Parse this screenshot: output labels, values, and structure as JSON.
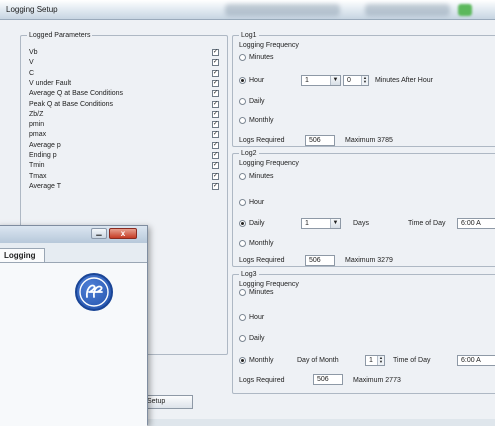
{
  "window": {
    "title": "Logging Setup"
  },
  "params": {
    "group_title": "Logged Parameters",
    "items": [
      {
        "label": "Vb",
        "checked": true
      },
      {
        "label": "V",
        "checked": true
      },
      {
        "label": "C",
        "checked": true
      },
      {
        "label": "V under Fault",
        "checked": true
      },
      {
        "label": "Average Q at Base Conditions",
        "checked": true
      },
      {
        "label": "Peak Q at Base Conditions",
        "checked": true
      },
      {
        "label": "Zb/Z",
        "checked": true
      },
      {
        "label": "pmin",
        "checked": true
      },
      {
        "label": "pmax",
        "checked": true
      },
      {
        "label": "Average p",
        "checked": true
      },
      {
        "label": "Ending p",
        "checked": true
      },
      {
        "label": "Tmin",
        "checked": true
      },
      {
        "label": "Tmax",
        "checked": true
      },
      {
        "label": "Average T",
        "checked": true
      }
    ],
    "check_mark": "✓"
  },
  "log1": {
    "title": "Log1",
    "freq_label": "Logging Frequency",
    "options": [
      "Minutes",
      "Hour",
      "Daily",
      "Monthly"
    ],
    "selected": "Hour",
    "hour_select": "1",
    "minutes_spin": "0",
    "minutes_after_label": "Minutes After Hour",
    "logs_required_label": "Logs Required",
    "logs_required": "506",
    "maximum_label": "Maximum 3785"
  },
  "log2": {
    "title": "Log2",
    "freq_label": "Logging Frequency",
    "options": [
      "Minutes",
      "Hour",
      "Daily",
      "Monthly"
    ],
    "selected": "Daily",
    "days_select": "1",
    "days_label": "Days",
    "time_of_day_label": "Time of Day",
    "time_of_day": "6:00 A",
    "logs_required_label": "Logs Required",
    "logs_required": "506",
    "maximum_label": "Maximum 3279"
  },
  "log3": {
    "title": "Log3",
    "freq_label": "Logging Frequency",
    "options": [
      "Minutes",
      "Hour",
      "Daily",
      "Monthly"
    ],
    "selected": "Monthly",
    "day_of_month_label": "Day of Month",
    "day_of_month": "1",
    "time_of_day_label": "Time of Day",
    "time_of_day": "6:00 A",
    "logs_required_label": "Logs Required",
    "logs_required": "506",
    "maximum_label": "Maximum 2773"
  },
  "overlay": {
    "tab_label": "Logging",
    "min_glyph": "▁",
    "close_glyph": "x",
    "logo_icon": "ge-logo",
    "button_label": "Setup"
  },
  "colors": {
    "ge_blue": "#1f4fa8"
  }
}
